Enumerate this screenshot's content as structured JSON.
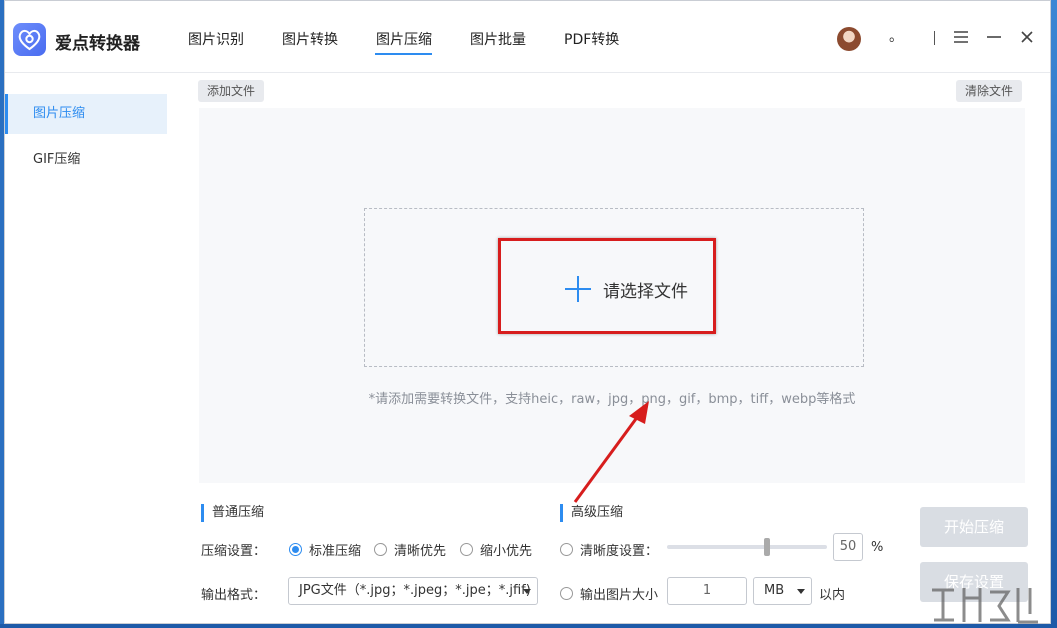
{
  "app": {
    "name": "爱点转换器"
  },
  "nav": {
    "tabs": [
      "图片识别",
      "图片转换",
      "图片压缩",
      "图片批量",
      "PDF转换"
    ],
    "active": "图片压缩"
  },
  "titlebar": {
    "dot": "。"
  },
  "sidebar": {
    "items": [
      "图片压缩",
      "GIF压缩"
    ],
    "active": "图片压缩"
  },
  "toolbar": {
    "add_file": "添加文件",
    "clear_file": "清除文件"
  },
  "dropzone": {
    "select_label": "请选择文件",
    "hint": "*请添加需要转换文件，支持heic，raw，jpg，png，gif，bmp，tiff，webp等格式"
  },
  "normal": {
    "title": "普通压缩",
    "setting_label": "压缩设置：",
    "options": [
      "标准压缩",
      "清晰优先",
      "缩小优先"
    ],
    "selected": "标准压缩",
    "format_label": "输出格式：",
    "format_value": "JPG文件（*.jpg；*.jpeg；*.jpe；*.jfif)"
  },
  "advanced": {
    "title": "高级压缩",
    "clarity_label": "清晰度设置：",
    "clarity_value": "50",
    "clarity_percent": 50,
    "percent_unit": "%",
    "size_label": "输出图片大小",
    "size_value": "1",
    "size_unit": "MB",
    "size_suffix": "以内"
  },
  "actions": {
    "start": "开始压缩",
    "save": "保存设置"
  },
  "colors": {
    "accent": "#2d8cf0",
    "annotation_red": "#d71d1d",
    "disabled_button": "#d9dde3"
  }
}
